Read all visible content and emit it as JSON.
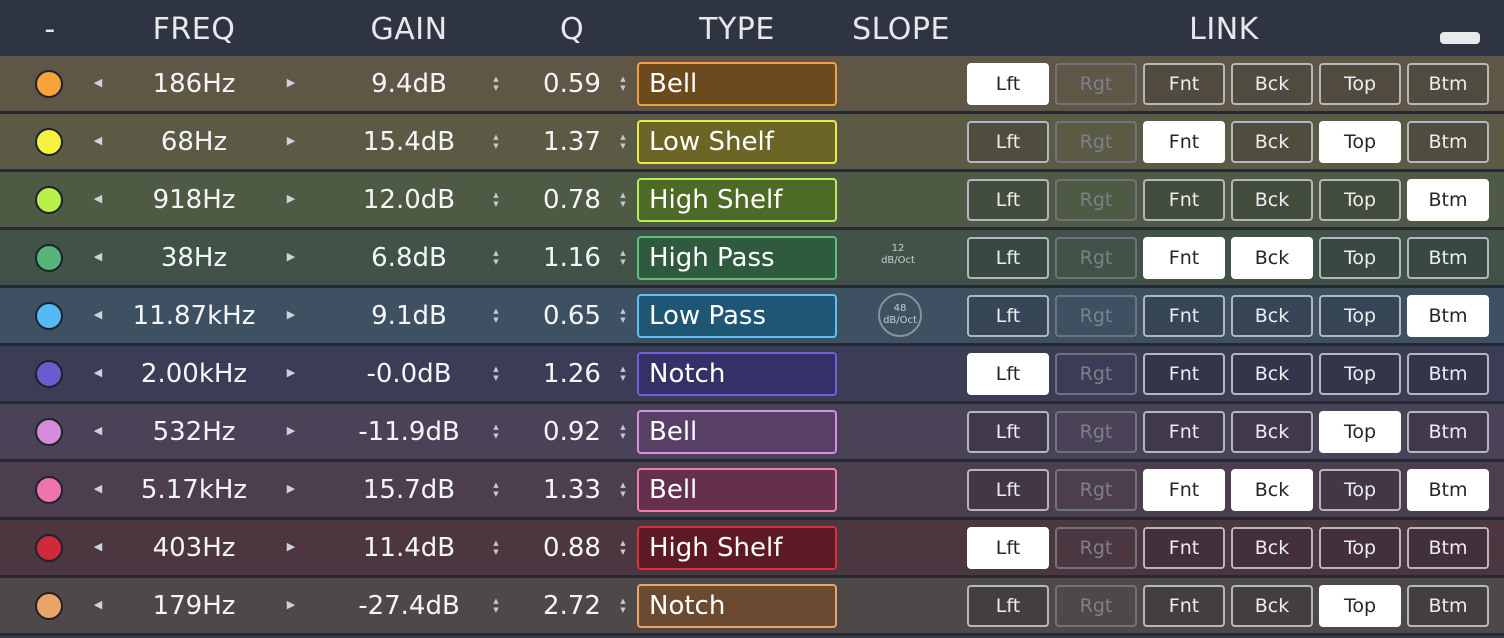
{
  "header": {
    "dash": "-",
    "freq": "FREQ",
    "gain": "GAIN",
    "q": "Q",
    "type": "TYPE",
    "slope": "SLOPE",
    "link": "LINK"
  },
  "glyphs": {
    "left_arrow": "◀",
    "right_arrow": "▶",
    "up": "▲",
    "down": "▼"
  },
  "bands": [
    {
      "color": "#f5a33a",
      "row_bg": "#5f5646",
      "type_fill": "#6c4a1e",
      "type_border": "#f0a040",
      "freq": "186Hz",
      "gain": "9.4dB",
      "q": "0.59",
      "type": "Bell",
      "slope": "",
      "link": {
        "Lft": "on",
        "Rgt": "dim",
        "Fnt": "off",
        "Bck": "off",
        "Top": "off",
        "Btm": "off"
      }
    },
    {
      "color": "#f6f13e",
      "row_bg": "#5b5a45",
      "type_fill": "#6b6626",
      "type_border": "#ecea4a",
      "freq": "68Hz",
      "gain": "15.4dB",
      "q": "1.37",
      "type": "Low Shelf",
      "slope": "",
      "link": {
        "Lft": "off",
        "Rgt": "dim",
        "Fnt": "on",
        "Bck": "off",
        "Top": "on",
        "Btm": "off"
      }
    },
    {
      "color": "#b9f04a",
      "row_bg": "#4e5a44",
      "type_fill": "#4e6a27",
      "type_border": "#b8ec58",
      "freq": "918Hz",
      "gain": "12.0dB",
      "q": "0.78",
      "type": "High Shelf",
      "slope": "",
      "link": {
        "Lft": "off",
        "Rgt": "dim",
        "Fnt": "off",
        "Bck": "off",
        "Top": "off",
        "Btm": "on"
      }
    },
    {
      "color": "#55b477",
      "row_bg": "#415349",
      "type_fill": "#2f5a3e",
      "type_border": "#5cbf7f",
      "freq": "38Hz",
      "gain": "6.8dB",
      "q": "1.16",
      "type": "High Pass",
      "slope_num": "12",
      "slope_unit": "dB/Oct",
      "slope_style": "plain",
      "link": {
        "Lft": "off",
        "Rgt": "dim",
        "Fnt": "on",
        "Bck": "on",
        "Top": "off",
        "Btm": "off"
      }
    },
    {
      "color": "#54b9f5",
      "row_bg": "#3e5162",
      "type_fill": "#1f5673",
      "type_border": "#5cc0f6",
      "freq": "11.87kHz",
      "gain": "9.1dB",
      "q": "0.65",
      "type": "Low Pass",
      "slope_num": "48",
      "slope_unit": "dB/Oct",
      "slope_style": "ring",
      "link": {
        "Lft": "off",
        "Rgt": "dim",
        "Fnt": "off",
        "Bck": "off",
        "Top": "off",
        "Btm": "on"
      }
    },
    {
      "color": "#6a5bd0",
      "row_bg": "#3b3c55",
      "type_fill": "#343068",
      "type_border": "#6e60d6",
      "freq": "2.00kHz",
      "gain": "-0.0dB",
      "q": "1.26",
      "type": "Notch",
      "slope": "",
      "link": {
        "Lft": "on",
        "Rgt": "dim",
        "Fnt": "off",
        "Bck": "off",
        "Top": "off",
        "Btm": "off"
      }
    },
    {
      "color": "#d68ad8",
      "row_bg": "#4a4256",
      "type_fill": "#583f66",
      "type_border": "#d88ee0",
      "freq": "532Hz",
      "gain": "-11.9dB",
      "q": "0.92",
      "type": "Bell",
      "slope": "",
      "link": {
        "Lft": "off",
        "Rgt": "dim",
        "Fnt": "off",
        "Bck": "off",
        "Top": "on",
        "Btm": "off"
      }
    },
    {
      "color": "#ef73ad",
      "row_bg": "#4d3e4f",
      "type_fill": "#64304e",
      "type_border": "#f07db2",
      "freq": "5.17kHz",
      "gain": "15.7dB",
      "q": "1.33",
      "type": "Bell",
      "slope": "",
      "link": {
        "Lft": "off",
        "Rgt": "dim",
        "Fnt": "on",
        "Bck": "on",
        "Top": "off",
        "Btm": "on"
      }
    },
    {
      "color": "#cf2a3a",
      "row_bg": "#4c3640",
      "type_fill": "#5e1a24",
      "type_border": "#d8323f",
      "freq": "403Hz",
      "gain": "11.4dB",
      "q": "0.88",
      "type": "High Shelf",
      "slope": "",
      "link": {
        "Lft": "on",
        "Rgt": "dim",
        "Fnt": "off",
        "Bck": "off",
        "Top": "off",
        "Btm": "off"
      }
    },
    {
      "color": "#eba468",
      "row_bg": "#4e4848",
      "type_fill": "#6a4a30",
      "type_border": "#eca46a",
      "freq": "179Hz",
      "gain": "-27.4dB",
      "q": "2.72",
      "type": "Notch",
      "slope": "",
      "link": {
        "Lft": "off",
        "Rgt": "dim",
        "Fnt": "off",
        "Bck": "off",
        "Top": "on",
        "Btm": "off"
      }
    }
  ],
  "link_labels": [
    "Lft",
    "Rgt",
    "Fnt",
    "Bck",
    "Top",
    "Btm"
  ]
}
